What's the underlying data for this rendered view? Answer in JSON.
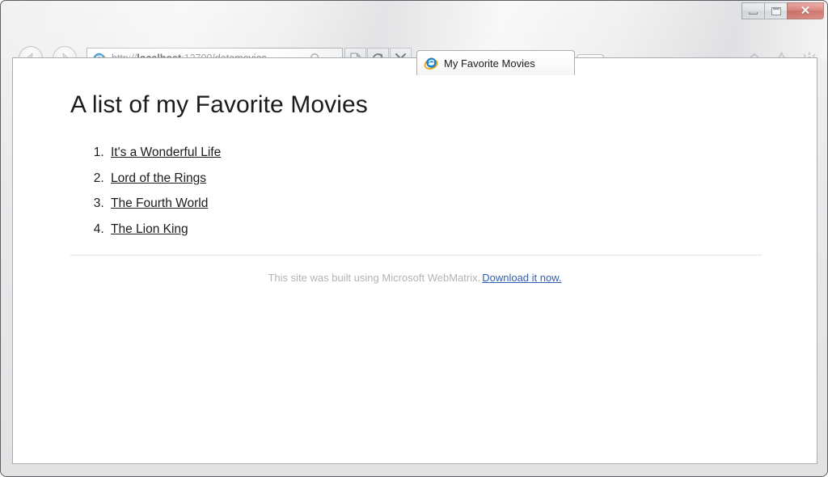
{
  "window": {
    "caption_buttons": {
      "minimize_label": "Minimize",
      "maximize_label": "Maximize",
      "close_label": "✕"
    }
  },
  "browser": {
    "back_label": "Back",
    "forward_label": "Forward",
    "address": {
      "url_prefix": "http://",
      "url_host": "localhost",
      "url_rest": ":12700/datamovies.",
      "placeholder": "",
      "search_icon": "search-icon",
      "dropdown_icon": "chevron-down-icon"
    },
    "toolbar": {
      "compatibility_label": "Compatibility View",
      "refresh_label": "Refresh",
      "stop_label": "Stop"
    },
    "tabs": [
      {
        "label": "My Favorite Movies",
        "active": true
      }
    ],
    "new_tab_label": "New Tab",
    "right_icons": [
      {
        "name": "home-icon",
        "label": "Home"
      },
      {
        "name": "favorites-star-icon",
        "label": "Favorites"
      },
      {
        "name": "settings-gear-icon",
        "label": "Tools"
      }
    ]
  },
  "page": {
    "title": "A list of my Favorite Movies",
    "movies": [
      {
        "title": "It's a Wonderful Life"
      },
      {
        "title": "Lord of the Rings"
      },
      {
        "title": "The Fourth World"
      },
      {
        "title": "The Lion King"
      }
    ],
    "footer": {
      "text": "This site was built using Microsoft WebMatrix.",
      "link_text": "Download it now."
    }
  },
  "colors": {
    "link_blue": "#2f5fae",
    "footer_gray": "#b3b3b3",
    "close_red": "#bc3a2d",
    "text_black": "#1b1b1b"
  }
}
